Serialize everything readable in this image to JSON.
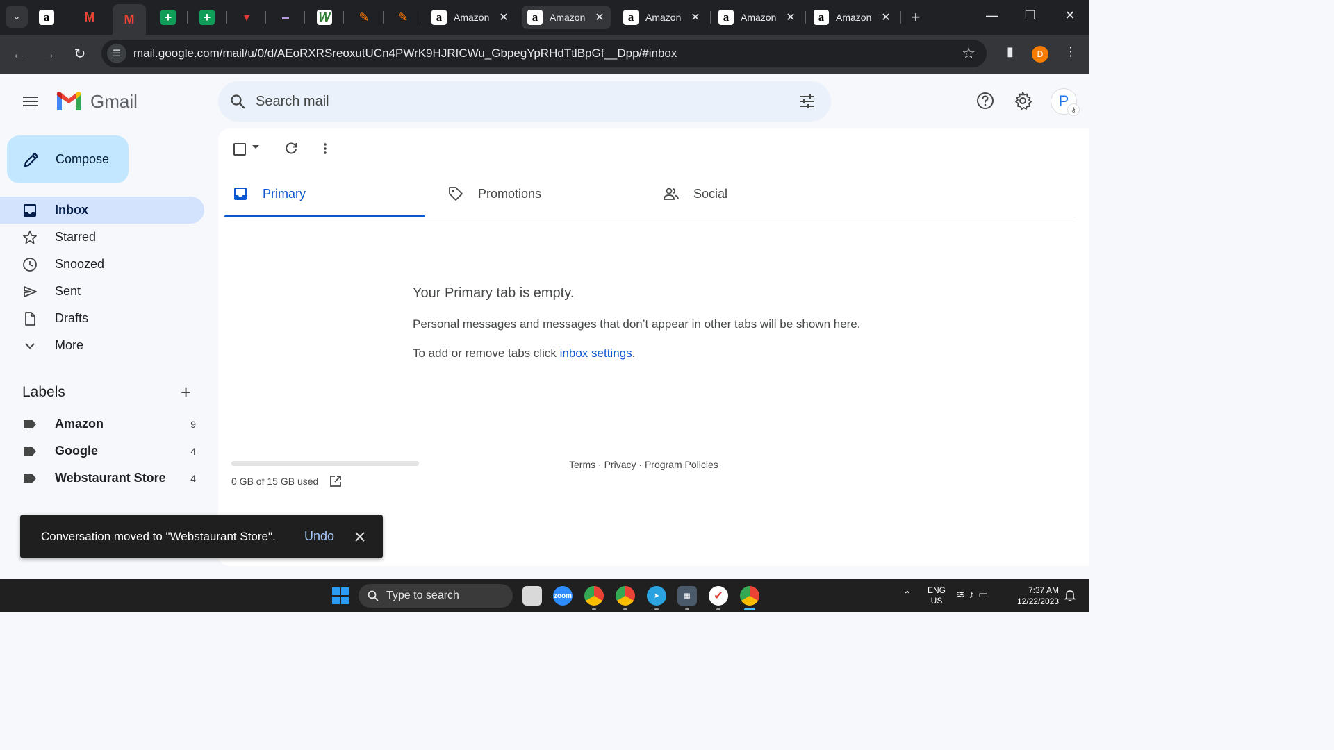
{
  "browser": {
    "tabs": [
      {
        "title": "Amazon",
        "close": "✕"
      },
      {
        "title": "Amazon",
        "close": "✕"
      },
      {
        "title": "Amazon",
        "close": "✕"
      },
      {
        "title": "Amazon",
        "close": "✕"
      },
      {
        "title": "Amazon",
        "close": "✕"
      }
    ],
    "url": "mail.google.com/mail/u/0/d/AEoRXRSreoxutUCn4PWrK9HJRfCWu_GbpegYpRHdTtlBpGf__Dpp/#inbox",
    "profile_initial": "D"
  },
  "gmail": {
    "brand": "Gmail",
    "search_placeholder": "Search mail",
    "account_initial": "P",
    "compose_label": "Compose",
    "nav": [
      {
        "label": "Inbox"
      },
      {
        "label": "Starred"
      },
      {
        "label": "Snoozed"
      },
      {
        "label": "Sent"
      },
      {
        "label": "Drafts"
      },
      {
        "label": "More"
      }
    ],
    "labels_title": "Labels",
    "labels": [
      {
        "name": "Amazon",
        "count": "9"
      },
      {
        "name": "Google",
        "count": "4"
      },
      {
        "name": "Webstaurant Store",
        "count": "4"
      }
    ],
    "category_tabs": [
      {
        "label": "Primary"
      },
      {
        "label": "Promotions"
      },
      {
        "label": "Social"
      }
    ],
    "empty_state": {
      "title": "Your Primary tab is empty.",
      "line1": "Personal messages and messages that don’t appear in other tabs will be shown here.",
      "line2_prefix": "To add or remove tabs click ",
      "line2_link": "inbox settings",
      "line2_suffix": "."
    },
    "storage": {
      "text": "0 GB of 15 GB used",
      "used_fraction": 0
    },
    "footer": {
      "terms": "Terms",
      "privacy": "Privacy",
      "policies": "Program Policies",
      "sep": " · "
    },
    "snackbar": {
      "message": "Conversation moved to \"Webstaurant Store\".",
      "undo": "Undo"
    },
    "colors": {
      "accent": "#0b57d0",
      "compose_bg": "#c2e7ff",
      "active_nav": "#d3e3fd"
    }
  },
  "taskbar": {
    "search_placeholder": "Type to search",
    "lang_line1": "ENG",
    "lang_line2": "US",
    "time": "7:37 AM",
    "date": "12/22/2023"
  }
}
